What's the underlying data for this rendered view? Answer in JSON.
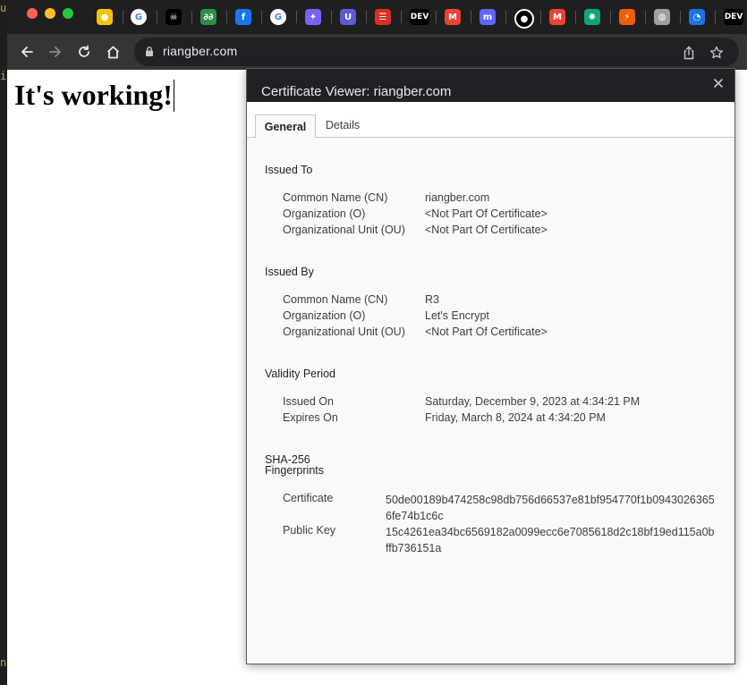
{
  "browser": {
    "url": "riangber.com",
    "tab_favicons": [
      {
        "name": "lock-favicon-icon",
        "glyph": "●",
        "color": "#f4c20d"
      },
      {
        "name": "google-favicon-icon",
        "glyph": "G",
        "color": "#4285f4"
      },
      {
        "name": "pirate-favicon-icon",
        "glyph": "☠",
        "color": "#000000"
      },
      {
        "name": "geeksforgeeks-favicon-icon",
        "glyph": "∂∂",
        "color": "#2f8d46"
      },
      {
        "name": "facebook-favicon-icon",
        "glyph": "f",
        "color": "#1877f2"
      },
      {
        "name": "google-favicon-icon-2",
        "glyph": "G",
        "color": "#4285f4"
      },
      {
        "name": "sparkle-favicon-icon",
        "glyph": "✦",
        "color": "#7b61ff"
      },
      {
        "name": "u-favicon-icon",
        "glyph": "U",
        "color": "#5b5bd6"
      },
      {
        "name": "list-favicon-icon",
        "glyph": "☰",
        "color": "#d93025"
      },
      {
        "name": "dev-favicon-icon",
        "glyph": "DEV",
        "color": "#000000"
      },
      {
        "name": "gmail-favicon-icon",
        "glyph": "M",
        "color": "#ea4335"
      },
      {
        "name": "mastodon-favicon-icon",
        "glyph": "m",
        "color": "#6364ff"
      },
      {
        "name": "github-favicon-icon",
        "glyph": "●",
        "color": "#ffffff"
      },
      {
        "name": "gmail-favicon-icon-2",
        "glyph": "M",
        "color": "#ea4335"
      },
      {
        "name": "chatgpt-favicon-icon",
        "glyph": "✺",
        "color": "#10a37f"
      },
      {
        "name": "zap-favicon-icon",
        "glyph": "⚡",
        "color": "#f25c05"
      },
      {
        "name": "globe-favicon-icon",
        "glyph": "◍",
        "color": "#9aa0a6"
      },
      {
        "name": "loader-favicon-icon",
        "glyph": "◔",
        "color": "#1a73e8"
      },
      {
        "name": "dev-favicon-icon-2",
        "glyph": "DEV",
        "color": "#000000"
      }
    ]
  },
  "page": {
    "heading": "It's working!"
  },
  "dialog": {
    "title": "Certificate Viewer: riangber.com",
    "tabs": [
      {
        "label": "General",
        "active": true
      },
      {
        "label": "Details",
        "active": false
      }
    ],
    "issued_to": {
      "title": "Issued To",
      "rows": [
        {
          "label": "Common Name (CN)",
          "value": "riangber.com"
        },
        {
          "label": "Organization (O)",
          "value": "<Not Part Of Certificate>"
        },
        {
          "label": "Organizational Unit (OU)",
          "value": "<Not Part Of Certificate>"
        }
      ]
    },
    "issued_by": {
      "title": "Issued By",
      "rows": [
        {
          "label": "Common Name (CN)",
          "value": "R3"
        },
        {
          "label": "Organization (O)",
          "value": "Let's Encrypt"
        },
        {
          "label": "Organizational Unit (OU)",
          "value": "<Not Part Of Certificate>"
        }
      ]
    },
    "validity": {
      "title": "Validity Period",
      "rows": [
        {
          "label": "Issued On",
          "value": "Saturday, December 9, 2023 at 4:34:21 PM"
        },
        {
          "label": "Expires On",
          "value": "Friday, March 8, 2024 at 4:34:20 PM"
        }
      ]
    },
    "fingerprints": {
      "title_line1": "SHA-256",
      "title_line2": "Fingerprints",
      "rows": [
        {
          "label": "Certificate",
          "value": "50de00189b474258c98db756d66537e81bf954770f1b09430263656fe74b1c6c"
        },
        {
          "label": "Public Key",
          "value": "15c4261ea34bc6569182a0099ecc6e7085618d2c18bf19ed115a0bffb736151a"
        }
      ]
    }
  }
}
